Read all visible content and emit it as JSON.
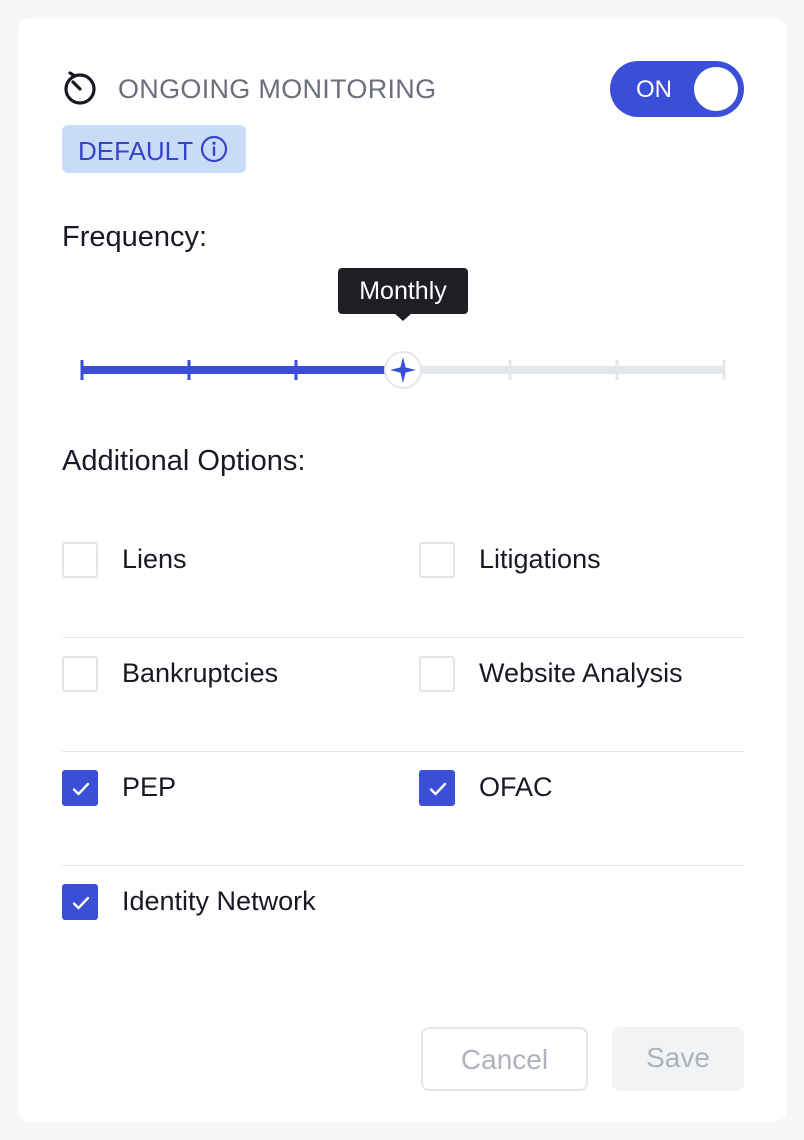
{
  "header": {
    "title": "ONGOING MONITORING",
    "icon": "timer-icon",
    "toggle_label": "ON",
    "toggle_on": true
  },
  "badge": {
    "label": "DEFAULT",
    "icon": "info-icon"
  },
  "frequency": {
    "label": "Frequency:",
    "selected_label": "Monthly",
    "steps": 7,
    "selected_index": 3
  },
  "options": {
    "label": "Additional Options:",
    "rows": [
      [
        {
          "label": "Liens",
          "checked": false
        },
        {
          "label": "Litigations",
          "checked": false
        }
      ],
      [
        {
          "label": "Bankruptcies",
          "checked": false
        },
        {
          "label": "Website Analysis",
          "checked": false
        }
      ],
      [
        {
          "label": "PEP",
          "checked": true
        },
        {
          "label": "OFAC",
          "checked": true
        }
      ],
      [
        {
          "label": "Identity Network",
          "checked": true
        }
      ]
    ]
  },
  "footer": {
    "cancel_label": "Cancel",
    "save_label": "Save"
  },
  "colors": {
    "accent": "#3a4ed8",
    "badge_bg": "#c9dcf7",
    "track_inactive": "#e3e6ec",
    "tooltip_bg": "#1d1f24"
  }
}
